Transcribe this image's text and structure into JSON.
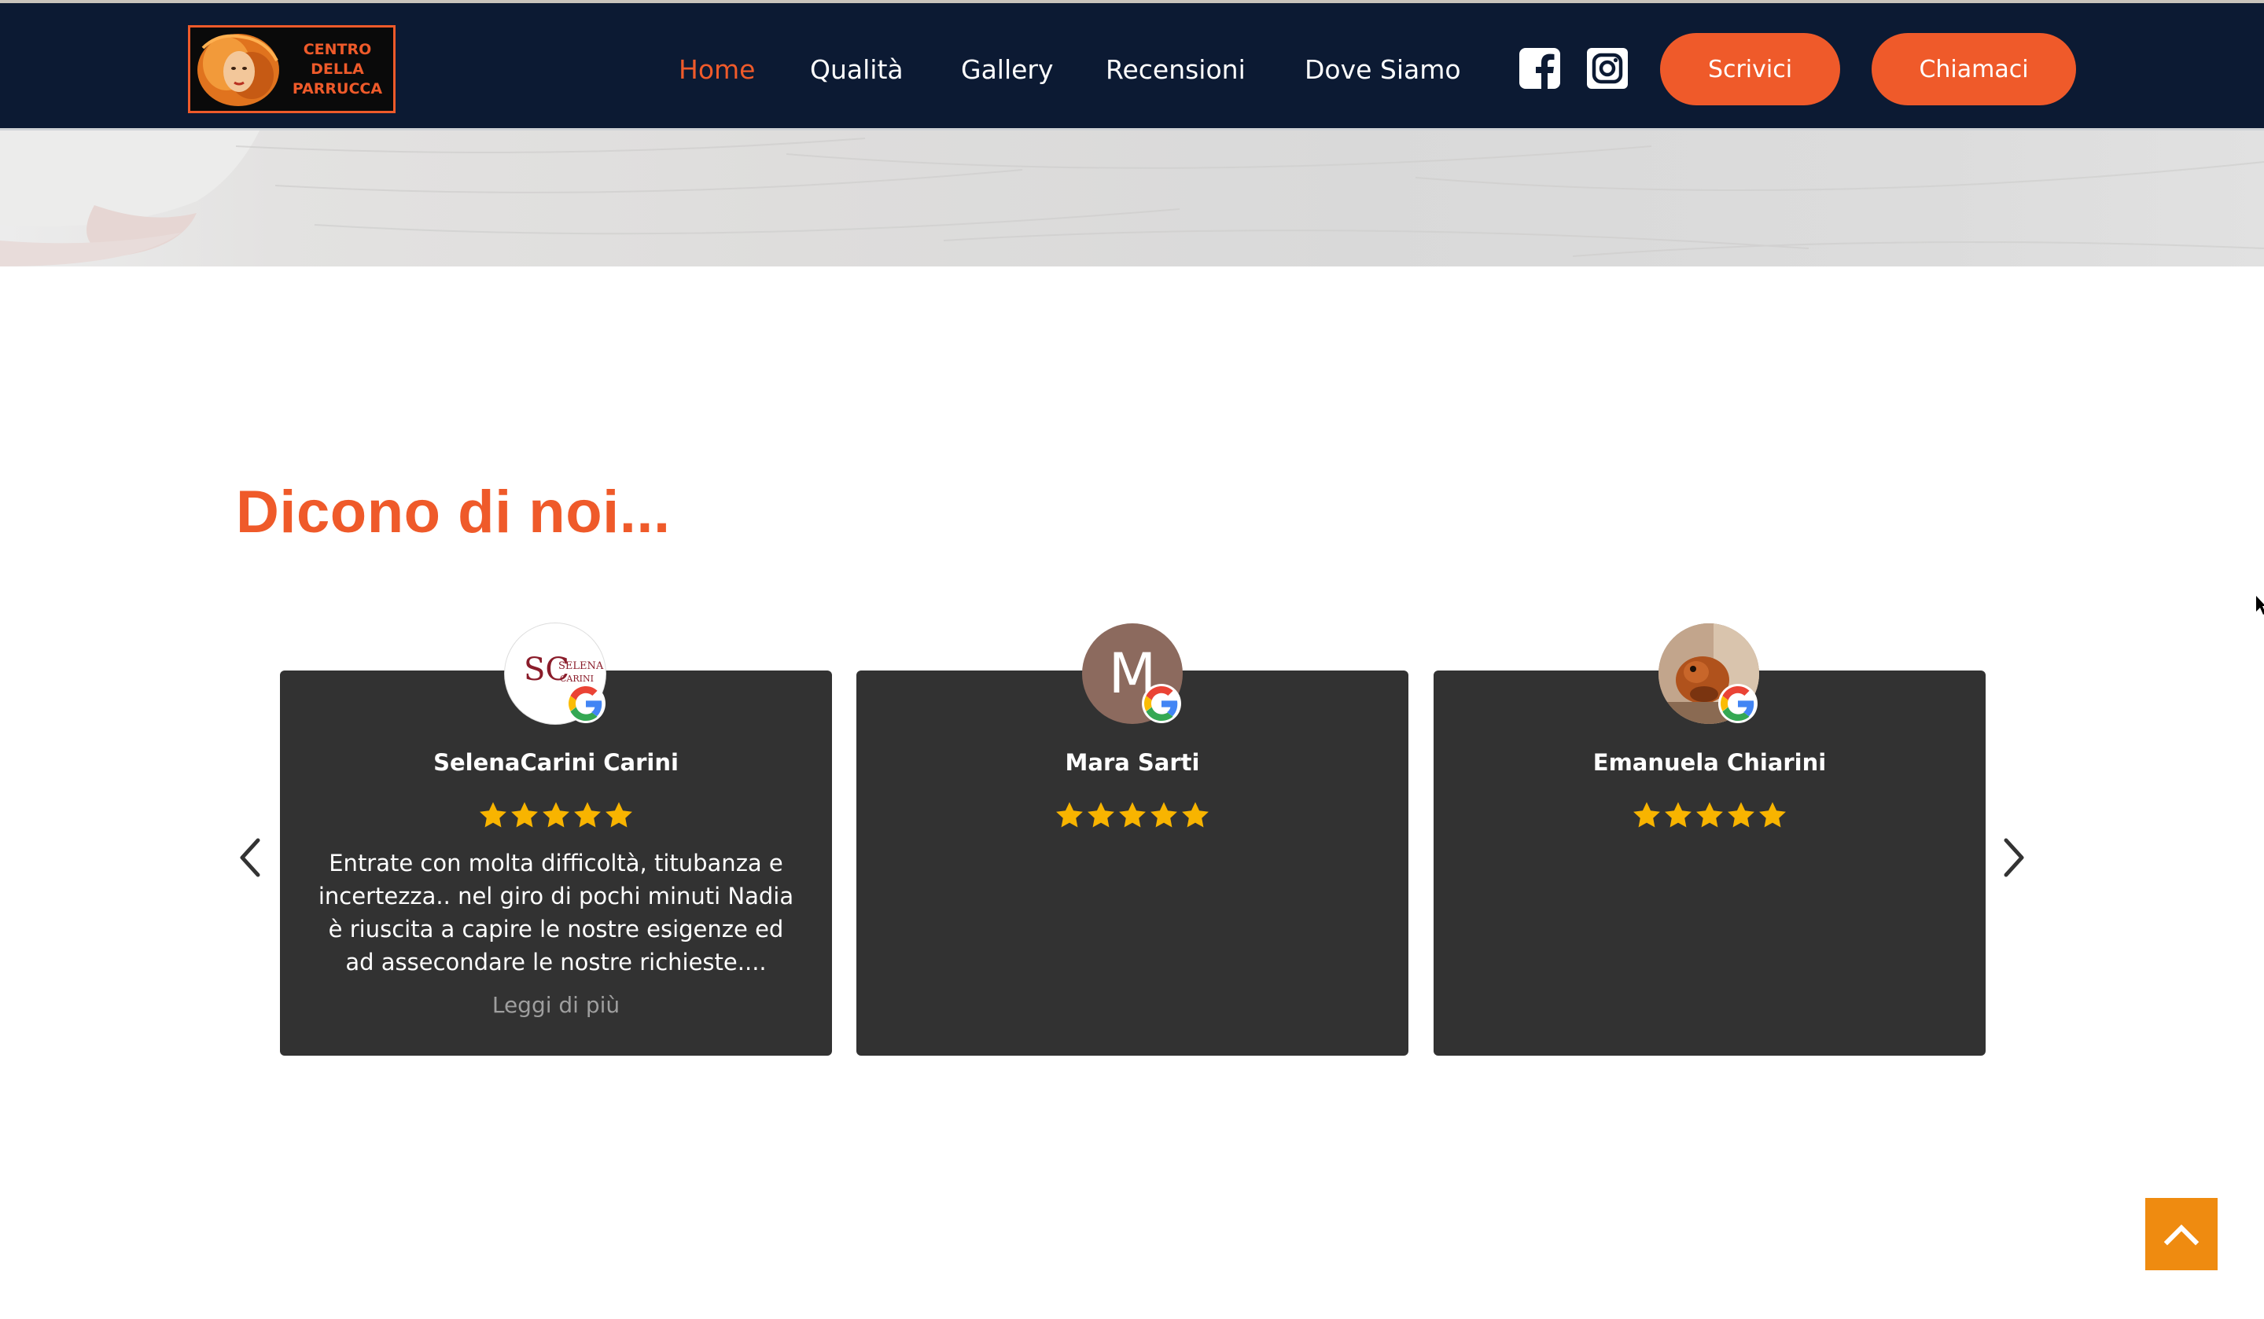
{
  "header": {
    "logo": {
      "lines": [
        "CENTRO",
        "DELLA",
        "PARRUCCA"
      ]
    },
    "nav": [
      {
        "label": "Home",
        "active": true
      },
      {
        "label": "Qualità",
        "active": false
      },
      {
        "label": "Gallery",
        "active": false
      },
      {
        "label": "Recensioni",
        "active": false
      },
      {
        "label": "Dove Siamo",
        "active": false
      }
    ],
    "social": [
      {
        "icon": "facebook-icon"
      },
      {
        "icon": "instagram-icon"
      }
    ],
    "buttons": {
      "write": "Scrivici",
      "call": "Chiamaci"
    }
  },
  "reviews": {
    "title": "Dicono di noi...",
    "items": [
      {
        "name": "SelenaCarini Carini",
        "avatar": {
          "type": "logo",
          "lines": [
            "SELENA",
            "CARINI"
          ],
          "monogram": "SC"
        },
        "rating": 5,
        "text": "Entrate con molta difficoltà, titubanza e incertezza.. nel giro di pochi minuti Nadia è riuscita a capire le nostre esigenze ed ad assecondare le nostre richieste....",
        "read_more": "Leggi di più"
      },
      {
        "name": "Mara Sarti",
        "avatar": {
          "type": "initial",
          "initial": "M",
          "color": "#8c6a5e"
        },
        "rating": 5,
        "text": "",
        "read_more": ""
      },
      {
        "name": "Emanuela Chiarini",
        "avatar": {
          "type": "photo"
        },
        "rating": 5,
        "text": "",
        "read_more": ""
      }
    ]
  },
  "colors": {
    "brand_orange": "#ef5a2a",
    "header_bg": "#0c1a33",
    "card_bg": "#323232",
    "star": "#f8b400",
    "back_to_top": "#ef8b10"
  },
  "icons": {
    "prev": "chevron-left-icon",
    "next": "chevron-right-icon",
    "back_to_top": "chevron-up-icon",
    "review_source": "google-icon"
  }
}
